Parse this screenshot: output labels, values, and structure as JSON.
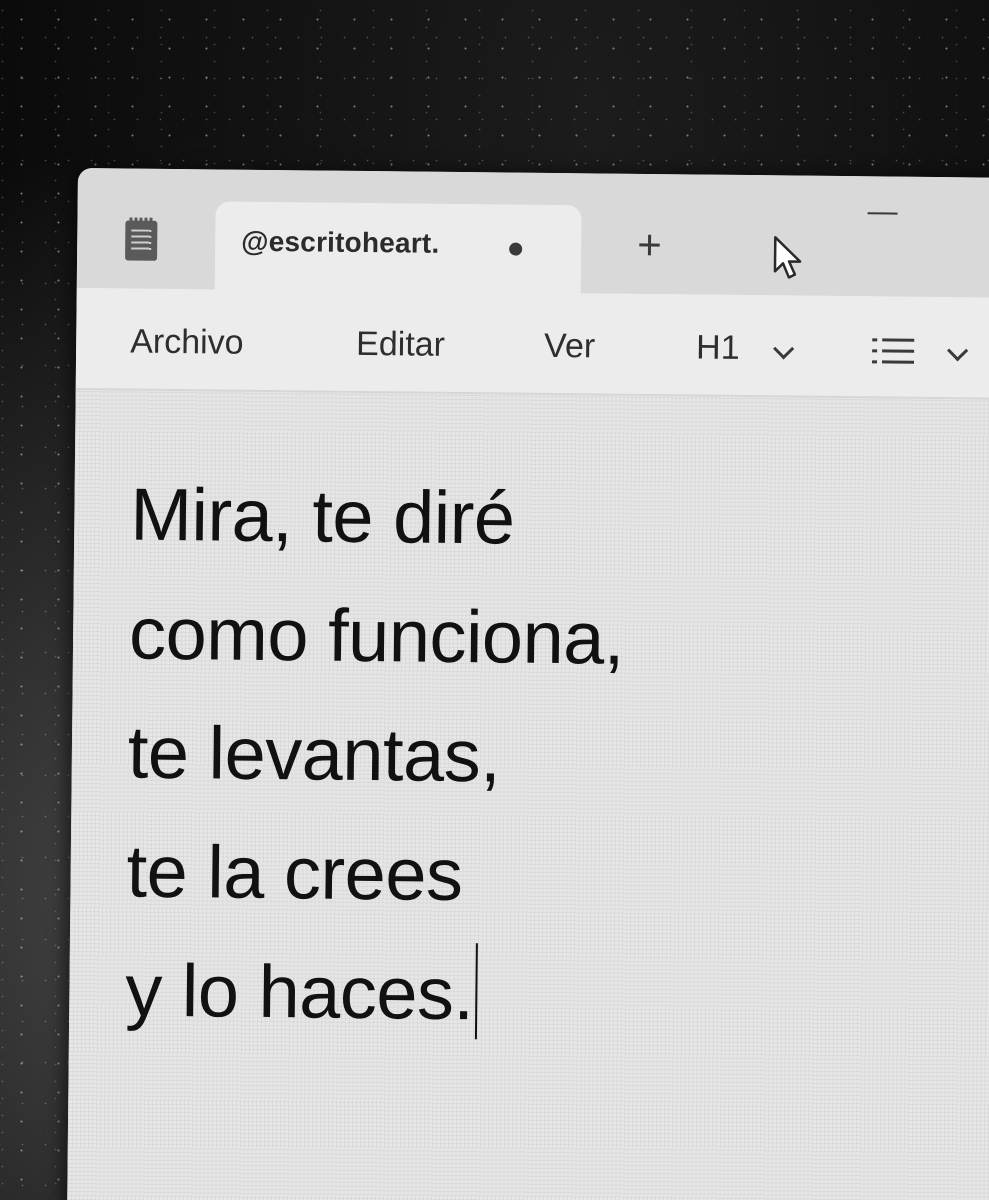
{
  "window": {
    "tab": {
      "title": "@escritoheart.",
      "unsaved_indicator": "dot",
      "new_tab_label": "+"
    },
    "app_icon": "notepad-icon"
  },
  "menubar": {
    "items": [
      "Archivo",
      "Editar",
      "Ver"
    ],
    "heading_select": {
      "value": "H1"
    },
    "list_select": {
      "icon": "bulleted-list-icon"
    }
  },
  "editor": {
    "lines": [
      "Mira, te diré",
      "como funciona,",
      "te levantas,",
      "te la crees",
      "y lo haces."
    ]
  },
  "colors": {
    "window_bg": "#ececec",
    "titlebar_bg": "#d9d9d9",
    "text": "#111111"
  }
}
